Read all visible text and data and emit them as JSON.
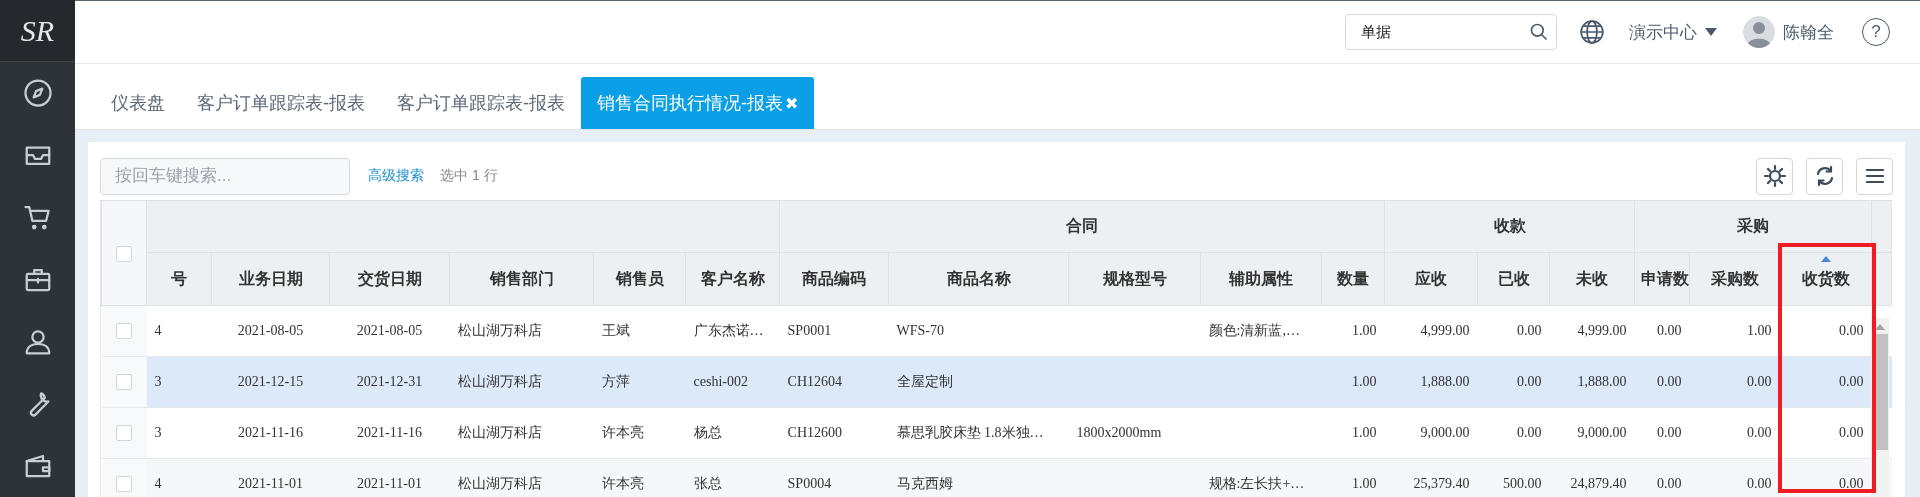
{
  "logo": "SR",
  "topbar": {
    "search": {
      "value": "单据"
    },
    "org": "演示中心",
    "user": "陈翰全",
    "help": "?"
  },
  "tabs": [
    {
      "label": "仪表盘",
      "selected": false
    },
    {
      "label": "客户订单跟踪表-报表",
      "selected": false
    },
    {
      "label": "客户订单跟踪表-报表",
      "selected": false
    },
    {
      "label": "销售合同执行情况-报表",
      "selected": true,
      "close": "✖"
    }
  ],
  "toolbar": {
    "search": {
      "placeholder": "按回车键搜索..."
    },
    "advanced_search": "高级搜索",
    "selection_info": "选中 1 行"
  },
  "table": {
    "column_groups": [
      {
        "columns": [
          {
            "label": "号",
            "kind": "text"
          },
          {
            "label": "业务日期",
            "kind": "date"
          },
          {
            "label": "交货日期",
            "kind": "date"
          },
          {
            "label": "销售部门",
            "kind": "text"
          },
          {
            "label": "销售员",
            "kind": "text"
          },
          {
            "label": "客户名称",
            "kind": "text"
          }
        ]
      },
      {
        "label": "合同",
        "columns": [
          {
            "label": "商品编码",
            "kind": "text"
          },
          {
            "label": "商品名称",
            "kind": "text"
          },
          {
            "label": "规格型号",
            "kind": "text"
          },
          {
            "label": "辅助属性",
            "kind": "text"
          },
          {
            "label": "数量",
            "kind": "number"
          }
        ]
      },
      {
        "label": "收款",
        "columns": [
          {
            "label": "应收",
            "kind": "number"
          },
          {
            "label": "已收",
            "kind": "number"
          },
          {
            "label": "未收",
            "kind": "number"
          }
        ]
      },
      {
        "label": "采购",
        "columns": [
          {
            "label": "申请数",
            "kind": "number"
          },
          {
            "label": "采购数",
            "kind": "number"
          },
          {
            "label": "收货数",
            "kind": "number",
            "sorted": true,
            "highlighted": true
          }
        ]
      }
    ],
    "all_checked": false,
    "rows": [
      {
        "checked": false,
        "selected": false,
        "cells": [
          "4",
          "2021-08-05",
          "2021-08-05",
          "松山湖万科店",
          "王斌",
          "广东杰诺…",
          "SP0001",
          "WFS-70",
          null,
          "颜色:清新蓝,…",
          "1.00",
          "4,999.00",
          "0.00",
          "4,999.00",
          "0.00",
          "1.00",
          "0.00"
        ]
      },
      {
        "checked": false,
        "selected": true,
        "cells": [
          "3",
          "2021-12-15",
          "2021-12-31",
          "松山湖万科店",
          "方萍",
          "ceshi-002",
          "CH12604",
          "全屋定制",
          null,
          null,
          "1.00",
          "1,888.00",
          "0.00",
          "1,888.00",
          "0.00",
          "0.00",
          "0.00"
        ]
      },
      {
        "checked": false,
        "selected": false,
        "cells": [
          "3",
          "2021-11-16",
          "2021-11-16",
          "松山湖万科店",
          "许本亮",
          "杨总",
          "CH12600",
          "慕思乳胶床垫 1.8米独…",
          "1800x2000mm",
          null,
          "1.00",
          "9,000.00",
          "0.00",
          "9,000.00",
          "0.00",
          "0.00",
          "0.00"
        ]
      },
      {
        "checked": false,
        "selected": false,
        "cells": [
          "4",
          "2021-11-01",
          "2021-11-01",
          "松山湖万科店",
          "许本亮",
          "张总",
          "SP0004",
          "马克西姆",
          null,
          "规格:左长扶+…",
          "1.00",
          "25,379.40",
          "500.00",
          "24,879.40",
          "0.00",
          "0.00",
          "0.00"
        ]
      }
    ]
  }
}
